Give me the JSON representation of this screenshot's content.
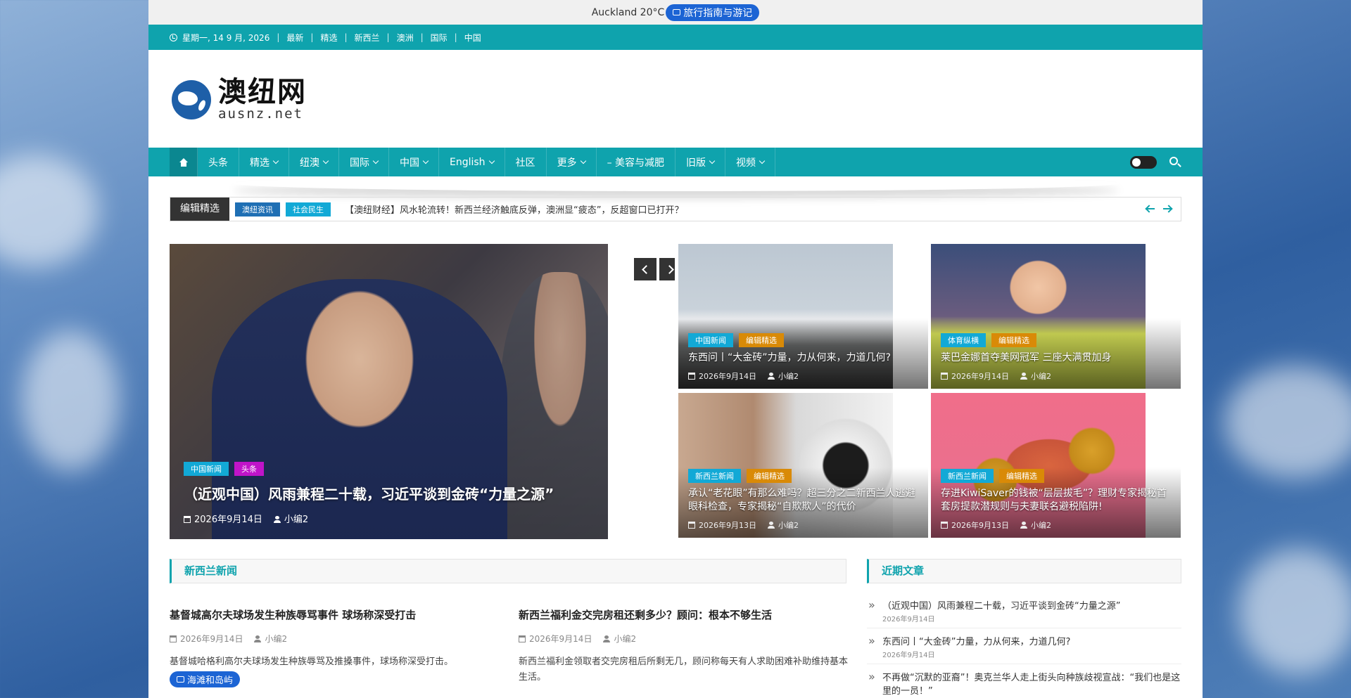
{
  "weather": {
    "text": "Auckland 20°C",
    "pill": "旅行指南与游记"
  },
  "topbar": {
    "date": "星期一, 14 9 月, 2026",
    "links": [
      "最新",
      "精选",
      "新西兰",
      "澳洲",
      "国际",
      "中国"
    ]
  },
  "logo": {
    "cn": "澳纽网",
    "en": "ausnz.net"
  },
  "nav": {
    "items": [
      "头条",
      "精选",
      "纽澳",
      "国际",
      "中国",
      "English",
      "社区",
      "更多",
      "– 美容与减肥",
      "旧版",
      "视频"
    ]
  },
  "ticker": {
    "label": "编辑精选",
    "tags": [
      "澳纽资讯",
      "社会民生"
    ],
    "text": "【澳纽财经】风水轮流转！新西兰经济触底反弹，澳洲显“疲态”，反超窗口已打开？"
  },
  "feature": {
    "tags": [
      "中国新闻",
      "头条"
    ],
    "title": "（近观中国）风雨兼程二十载，习近平谈到金砖“力量之源”",
    "date": "2026年9月14日",
    "author": "小编2"
  },
  "cards": [
    {
      "tags": [
        "中国新闻",
        "编辑精选"
      ],
      "title": "东西问丨“大金砖”力量，力从何来，力道几何?",
      "date": "2026年9月14日",
      "author": "小编2"
    },
    {
      "tags": [
        "体育纵横",
        "编辑精选"
      ],
      "title": "莱巴金娜首夺美网冠军 三座大满贯加身",
      "date": "2026年9月14日",
      "author": "小编2"
    },
    {
      "tags": [
        "新西兰新闻",
        "编辑精选"
      ],
      "title": "承认“老花眼”有那么难吗？超三分之二新西兰人逃避眼科检查，专家揭秘“自欺欺人”的代价",
      "date": "2026年9月13日",
      "author": "小编2"
    },
    {
      "tags": [
        "新西兰新闻",
        "编辑精选"
      ],
      "title": "存进KiwiSaver的钱被“层层拔毛”？理财专家揭秘首套房提款潜规则与夫妻联名避税陷阱!",
      "date": "2026年9月13日",
      "author": "小编2"
    }
  ],
  "sections": {
    "nz": "新西兰新闻",
    "recent": "近期文章"
  },
  "posts": [
    {
      "title": "基督城高尔夫球场发生种族辱骂事件 球场称深受打击",
      "date": "2026年9月14日",
      "author": "小编2",
      "excerpt": "基督城哈格利高尔夫球场发生种族辱骂及推搡事件，球场称深受打击。"
    },
    {
      "title": "新西兰福利金交完房租还剩多少？顾问：根本不够生活",
      "date": "2026年9月14日",
      "author": "小编2",
      "excerpt": "新西兰福利金领取者交完房租后所剩无几，顾问称每天有人求助困难补助维持基本生活。"
    }
  ],
  "island_pill": "海滩和岛屿",
  "recent": [
    {
      "title": "（近观中国）风雨兼程二十载，习近平谈到金砖“力量之源”",
      "date": "2026年9月14日"
    },
    {
      "title": "东西问丨“大金砖”力量，力从何来，力道几何?",
      "date": "2026年9月14日"
    },
    {
      "title": "不再做“沉默的亚裔”！奥克兰华人走上街头向种族歧视宣战：“我们也是这里的一员！”",
      "date": ""
    }
  ],
  "colors": {
    "teal": "#0fa3ad",
    "blue_pill": "#1c64d4",
    "tag_cyan": "#12a9d6",
    "tag_magenta": "#c014c9",
    "tag_orange": "#d98a07"
  }
}
